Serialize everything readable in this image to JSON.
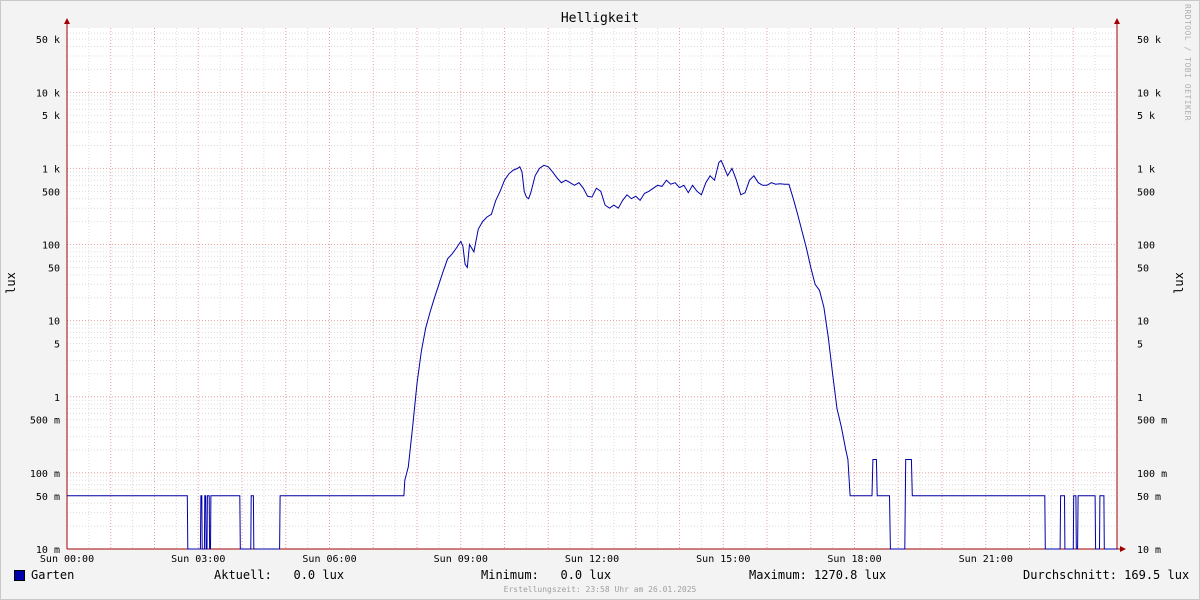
{
  "colors": {
    "background": "#f3f3f3",
    "plot_background": "#ffffff",
    "major_grid": "#e8a0a0",
    "minor_grid": "#dcdcdc",
    "series": "#0000aa",
    "axis": "#a00000"
  },
  "title": "Helligkeit",
  "watermark": "RRDTOOL / TOBI OETIKER",
  "legend": {
    "series_name": "Garten"
  },
  "stats": {
    "aktuell": "Aktuell:   0.0 lux",
    "minimum": "Minimum:   0.0 lux",
    "maximum": "Maximum: 1270.8 lux",
    "durchschnitt": "Durchschnitt: 169.5 lux"
  },
  "footer": "Erstellungszeit: 23:58 Uhr am 26.01.2025",
  "chart_data": {
    "type": "line",
    "title": "Helligkeit",
    "ylabel": "lux",
    "yscale": "log",
    "ylim": [
      0.01,
      70000
    ],
    "xlim": [
      0,
      24
    ],
    "y_tick_labels": [
      {
        "value": 50000,
        "label": "50 k"
      },
      {
        "value": 10000,
        "label": "10 k"
      },
      {
        "value": 5000,
        "label": "5 k"
      },
      {
        "value": 1000,
        "label": "1 k"
      },
      {
        "value": 500,
        "label": "500"
      },
      {
        "value": 100,
        "label": "100"
      },
      {
        "value": 50,
        "label": "50"
      },
      {
        "value": 10,
        "label": "10"
      },
      {
        "value": 5,
        "label": "5"
      },
      {
        "value": 1,
        "label": "1"
      },
      {
        "value": 0.5,
        "label": "500 m"
      },
      {
        "value": 0.1,
        "label": "100 m"
      },
      {
        "value": 0.05,
        "label": "50 m"
      },
      {
        "value": 0.01,
        "label": "10 m"
      }
    ],
    "x_tick_labels": [
      {
        "value": 0,
        "label": "Sun 00:00"
      },
      {
        "value": 3,
        "label": "Sun 03:00"
      },
      {
        "value": 6,
        "label": "Sun 06:00"
      },
      {
        "value": 9,
        "label": "Sun 09:00"
      },
      {
        "value": 12,
        "label": "Sun 12:00"
      },
      {
        "value": 15,
        "label": "Sun 15:00"
      },
      {
        "value": 18,
        "label": "Sun 18:00"
      },
      {
        "value": 21,
        "label": "Sun 21:00"
      }
    ],
    "grid": true,
    "series": [
      {
        "name": "Garten",
        "points": [
          [
            0,
            0.05
          ],
          [
            2.75,
            0.05
          ],
          [
            2.76,
            0.01
          ],
          [
            3.05,
            0.01
          ],
          [
            3.06,
            0.05
          ],
          [
            3.08,
            0.05
          ],
          [
            3.09,
            0.01
          ],
          [
            3.14,
            0.01
          ],
          [
            3.15,
            0.05
          ],
          [
            3.17,
            0.05
          ],
          [
            3.18,
            0.01
          ],
          [
            3.2,
            0.01
          ],
          [
            3.21,
            0.05
          ],
          [
            3.25,
            0.05
          ],
          [
            3.26,
            0.01
          ],
          [
            3.28,
            0.01
          ],
          [
            3.29,
            0.05
          ],
          [
            3.95,
            0.05
          ],
          [
            3.96,
            0.01
          ],
          [
            4.2,
            0.01
          ],
          [
            4.21,
            0.05
          ],
          [
            4.26,
            0.05
          ],
          [
            4.27,
            0.01
          ],
          [
            4.86,
            0.01
          ],
          [
            4.87,
            0.05
          ],
          [
            7.7,
            0.05
          ],
          [
            7.72,
            0.08
          ],
          [
            7.8,
            0.12
          ],
          [
            7.9,
            0.4
          ],
          [
            8.0,
            1.5
          ],
          [
            8.1,
            4
          ],
          [
            8.2,
            8
          ],
          [
            8.3,
            13
          ],
          [
            8.4,
            20
          ],
          [
            8.5,
            30
          ],
          [
            8.6,
            45
          ],
          [
            8.7,
            65
          ],
          [
            8.8,
            75
          ],
          [
            8.9,
            90
          ],
          [
            9.0,
            110
          ],
          [
            9.05,
            95
          ],
          [
            9.1,
            55
          ],
          [
            9.15,
            50
          ],
          [
            9.2,
            100
          ],
          [
            9.3,
            80
          ],
          [
            9.4,
            160
          ],
          [
            9.5,
            200
          ],
          [
            9.6,
            230
          ],
          [
            9.7,
            250
          ],
          [
            9.8,
            380
          ],
          [
            9.9,
            500
          ],
          [
            10.0,
            700
          ],
          [
            10.1,
            850
          ],
          [
            10.2,
            950
          ],
          [
            10.3,
            1000
          ],
          [
            10.35,
            1050
          ],
          [
            10.4,
            900
          ],
          [
            10.45,
            500
          ],
          [
            10.5,
            420
          ],
          [
            10.55,
            400
          ],
          [
            10.6,
            480
          ],
          [
            10.7,
            800
          ],
          [
            10.8,
            1000
          ],
          [
            10.9,
            1100
          ],
          [
            11.0,
            1050
          ],
          [
            11.1,
            900
          ],
          [
            11.2,
            750
          ],
          [
            11.3,
            650
          ],
          [
            11.4,
            700
          ],
          [
            11.5,
            650
          ],
          [
            11.6,
            600
          ],
          [
            11.7,
            650
          ],
          [
            11.8,
            550
          ],
          [
            11.9,
            430
          ],
          [
            12.0,
            420
          ],
          [
            12.1,
            550
          ],
          [
            12.2,
            500
          ],
          [
            12.3,
            330
          ],
          [
            12.4,
            300
          ],
          [
            12.5,
            330
          ],
          [
            12.6,
            300
          ],
          [
            12.7,
            380
          ],
          [
            12.8,
            450
          ],
          [
            12.9,
            400
          ],
          [
            13.0,
            430
          ],
          [
            13.1,
            380
          ],
          [
            13.2,
            470
          ],
          [
            13.3,
            500
          ],
          [
            13.4,
            550
          ],
          [
            13.5,
            600
          ],
          [
            13.6,
            580
          ],
          [
            13.7,
            700
          ],
          [
            13.8,
            620
          ],
          [
            13.9,
            650
          ],
          [
            14.0,
            560
          ],
          [
            14.1,
            600
          ],
          [
            14.2,
            480
          ],
          [
            14.3,
            600
          ],
          [
            14.4,
            500
          ],
          [
            14.5,
            450
          ],
          [
            14.6,
            650
          ],
          [
            14.7,
            800
          ],
          [
            14.8,
            700
          ],
          [
            14.9,
            1200
          ],
          [
            14.95,
            1270
          ],
          [
            15.0,
            1100
          ],
          [
            15.1,
            800
          ],
          [
            15.2,
            1000
          ],
          [
            15.3,
            700
          ],
          [
            15.4,
            450
          ],
          [
            15.5,
            480
          ],
          [
            15.6,
            700
          ],
          [
            15.7,
            800
          ],
          [
            15.8,
            650
          ],
          [
            15.9,
            600
          ],
          [
            16.0,
            600
          ],
          [
            16.1,
            650
          ],
          [
            16.2,
            620
          ],
          [
            16.3,
            630
          ],
          [
            16.4,
            620
          ],
          [
            16.5,
            620
          ],
          [
            16.6,
            400
          ],
          [
            16.7,
            250
          ],
          [
            16.8,
            150
          ],
          [
            16.9,
            90
          ],
          [
            17.0,
            50
          ],
          [
            17.1,
            30
          ],
          [
            17.2,
            25
          ],
          [
            17.3,
            15
          ],
          [
            17.4,
            6
          ],
          [
            17.5,
            2
          ],
          [
            17.6,
            0.7
          ],
          [
            17.7,
            0.4
          ],
          [
            17.8,
            0.2
          ],
          [
            17.85,
            0.15
          ],
          [
            17.9,
            0.05
          ],
          [
            18.4,
            0.05
          ],
          [
            18.42,
            0.15
          ],
          [
            18.5,
            0.15
          ],
          [
            18.52,
            0.05
          ],
          [
            18.8,
            0.05
          ],
          [
            18.82,
            0.01
          ],
          [
            19.15,
            0.01
          ],
          [
            19.17,
            0.15
          ],
          [
            19.3,
            0.15
          ],
          [
            19.32,
            0.05
          ],
          [
            22.35,
            0.05
          ],
          [
            22.36,
            0.01
          ],
          [
            22.7,
            0.01
          ],
          [
            22.71,
            0.05
          ],
          [
            22.8,
            0.05
          ],
          [
            22.81,
            0.01
          ],
          [
            23.0,
            0.01
          ],
          [
            23.01,
            0.05
          ],
          [
            23.06,
            0.05
          ],
          [
            23.07,
            0.01
          ],
          [
            23.1,
            0.01
          ],
          [
            23.11,
            0.05
          ],
          [
            23.5,
            0.05
          ],
          [
            23.51,
            0.01
          ],
          [
            23.6,
            0.01
          ],
          [
            23.61,
            0.05
          ],
          [
            23.7,
            0.05
          ],
          [
            23.71,
            0.01
          ],
          [
            24,
            0.01
          ]
        ]
      }
    ]
  }
}
